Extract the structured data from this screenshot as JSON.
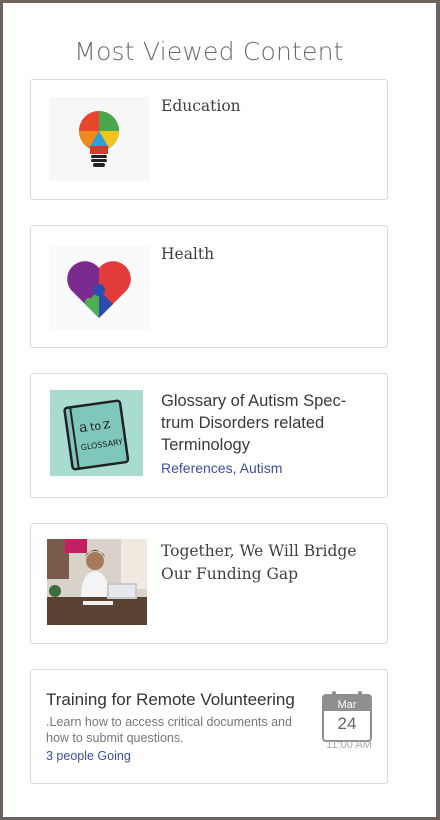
{
  "section_title": "Most Viewed Content",
  "cards": [
    {
      "title": "Education",
      "icon": "lightbulb-puzzle-icon"
    },
    {
      "title": "Health",
      "icon": "puzzle-heart-icon"
    },
    {
      "title": "Glossary of Autism Spec-trum Disorders related Terminology",
      "icon": "glossary-book-icon",
      "tags": [
        "References",
        "Autism"
      ],
      "tag_separator": ", "
    },
    {
      "title": "Together, We Will Bridge Our Funding Gap",
      "icon": "woman-at-laptop-photo"
    }
  ],
  "event": {
    "title": "Training for Remote Volunteering",
    "description": ".Learn how to access critical documents and how to submit questions.",
    "going": "3 people Going",
    "month": "Mar",
    "day": "24",
    "time": "11:00 AM"
  },
  "colors": {
    "link": "#3d4f9e",
    "frame": "#6e625d",
    "border": "#d9d9d9"
  }
}
